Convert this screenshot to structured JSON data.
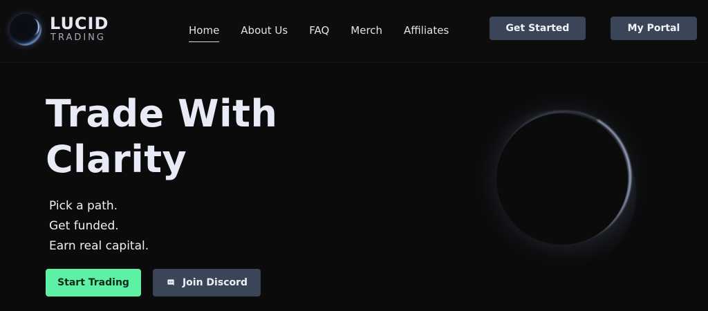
{
  "brand": {
    "name": "LUCID",
    "subtitle": "TRADING"
  },
  "nav": {
    "items": [
      {
        "label": "Home",
        "active": true
      },
      {
        "label": "About Us",
        "active": false
      },
      {
        "label": "FAQ",
        "active": false
      },
      {
        "label": "Merch",
        "active": false
      },
      {
        "label": "Affiliates",
        "active": false
      }
    ]
  },
  "header_buttons": {
    "get_started": "Get Started",
    "my_portal": "My Portal"
  },
  "hero": {
    "title_line1": "Trade With",
    "title_line2": "Clarity",
    "taglines": [
      "Pick a path.",
      "Get funded.",
      "Earn real capital."
    ]
  },
  "cta": {
    "start_trading": "Start Trading",
    "join_discord": "Join Discord",
    "discord_icon": "discord-icon"
  },
  "colors": {
    "background": "#0b0b0c",
    "button_slate": "#3a4558",
    "accent_green": "#5ef0a5"
  }
}
